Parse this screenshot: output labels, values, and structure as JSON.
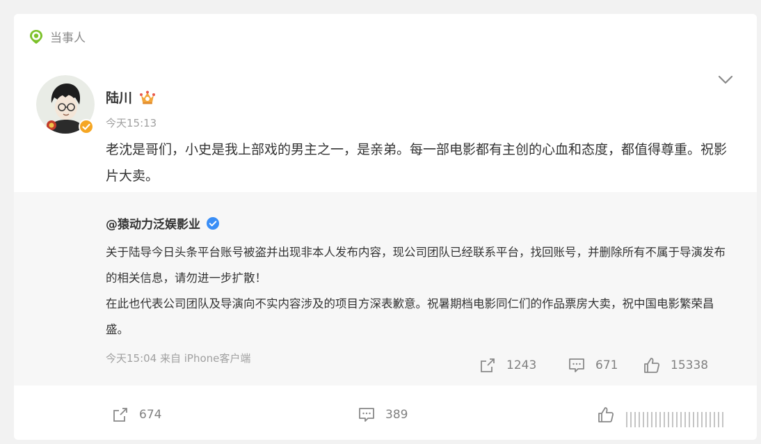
{
  "tag": {
    "label": "当事人"
  },
  "post": {
    "author": "陆川",
    "time": "今天15:13",
    "text": "老沈是哥们，小史是我上部戏的男主之一，是亲弟。每一部电影都有主创的心血和态度，都值得尊重。祝影片大卖。"
  },
  "repost": {
    "author": "@猿动力泛娱影业",
    "paragraph1": "关于陆导今日头条平台账号被盗并出现非本人发布内容，现公司团队已经联系平台，找回账号，并删除所有不属于导演发布的相关信息，请勿进一步扩散！",
    "paragraph2": "在此也代表公司团队及导演向不实内容涉及的项目方深表歉意。祝暑期档电影同仁们的作品票房大卖，祝中国电影繁荣昌盛。",
    "meta": "今天15:04 来自 iPhone客户端",
    "shares": "1243",
    "comments": "671",
    "likes": "15338"
  },
  "stats": {
    "shares": "674",
    "comments": "389"
  },
  "colors": {
    "accent_green": "#7cc12a",
    "verify_orange": "#f5a623",
    "verify_blue": "#3a8ef6",
    "crown_orange": "#f2a53a"
  },
  "icons": [
    "pin-icon",
    "crown-icon",
    "verified-icon",
    "chevron-down-icon",
    "share-icon",
    "comment-icon",
    "like-icon"
  ]
}
